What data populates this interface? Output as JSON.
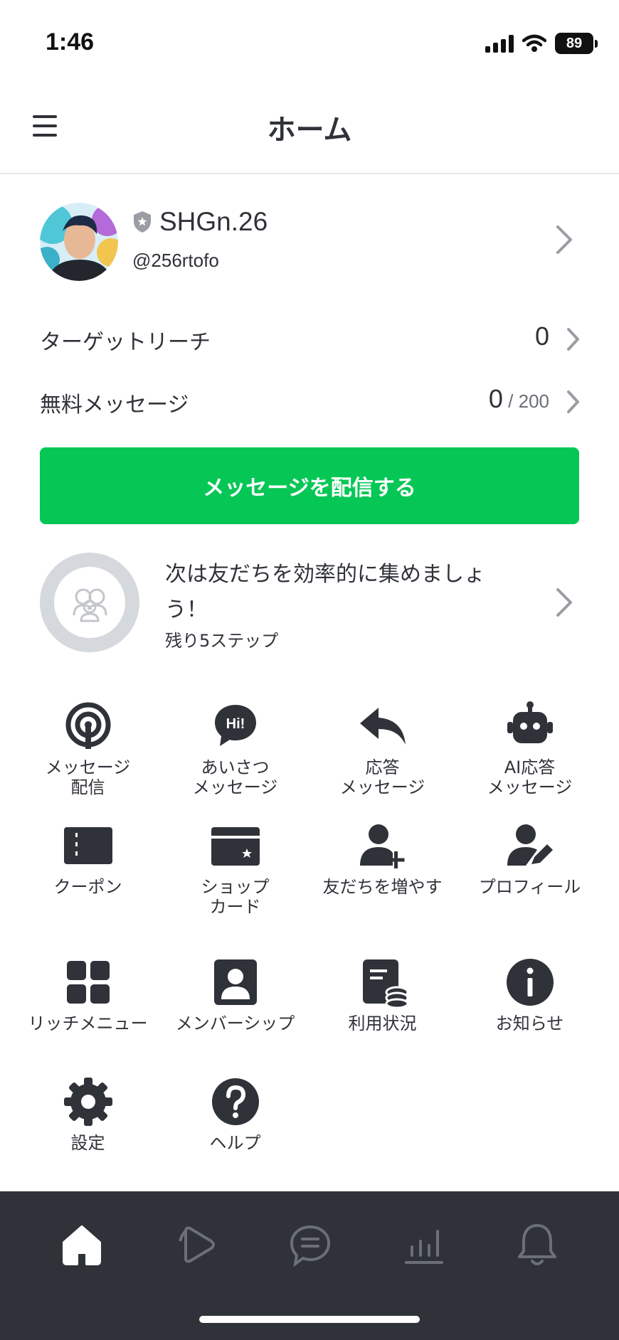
{
  "status_bar": {
    "time": "1:46",
    "battery": "89",
    "icons": [
      "signal-icon",
      "wifi-icon",
      "battery-icon"
    ]
  },
  "header": {
    "title": "ホーム",
    "menu_icon": "hamburger-menu-icon"
  },
  "profile": {
    "name": "SHGn.26",
    "id": "@256rtofo",
    "badge_icon": "shield-star-icon"
  },
  "stats": {
    "target_reach": {
      "label": "ターゲットリーチ",
      "value": "0"
    },
    "free_messages": {
      "label": "無料メッセージ",
      "value": "0",
      "limit": " / 200"
    }
  },
  "broadcast_button": {
    "label": "メッセージを配信する"
  },
  "progress": {
    "title": "次は友だちを効率的に集めましょう！",
    "subtitle": "残り5ステップ"
  },
  "menu_items": [
    {
      "label": "メッセージ\n配信",
      "icon": "broadcast-icon"
    },
    {
      "label": "あいさつ\nメッセージ",
      "icon": "greeting-message-icon"
    },
    {
      "label": "応答\nメッセージ",
      "icon": "reply-icon"
    },
    {
      "label": "AI応答\nメッセージ",
      "icon": "robot-icon"
    },
    {
      "label": "クーポン",
      "icon": "coupon-icon"
    },
    {
      "label": "ショップ\nカード",
      "icon": "shop-card-icon"
    },
    {
      "label": "友だちを増やす",
      "icon": "add-friend-icon"
    },
    {
      "label": "プロフィール",
      "icon": "profile-edit-icon"
    },
    {
      "label": "リッチメニュー",
      "icon": "rich-menu-icon"
    },
    {
      "label": "メンバーシップ",
      "icon": "membership-icon"
    },
    {
      "label": "利用状況",
      "icon": "usage-icon"
    },
    {
      "label": "お知らせ",
      "icon": "info-icon"
    },
    {
      "label": "設定",
      "icon": "gear-icon"
    },
    {
      "label": "ヘルプ",
      "icon": "help-icon"
    }
  ],
  "bottom_nav": [
    {
      "icon": "home-icon",
      "active": true
    },
    {
      "icon": "play-icon",
      "active": false
    },
    {
      "icon": "chat-icon",
      "active": false
    },
    {
      "icon": "analytics-icon",
      "active": false
    },
    {
      "icon": "bell-icon",
      "active": false
    }
  ],
  "colors": {
    "accent": "#06c755",
    "text": "#2f3238",
    "nav_background": "#2f3238",
    "chevron": "#9a9da3"
  }
}
